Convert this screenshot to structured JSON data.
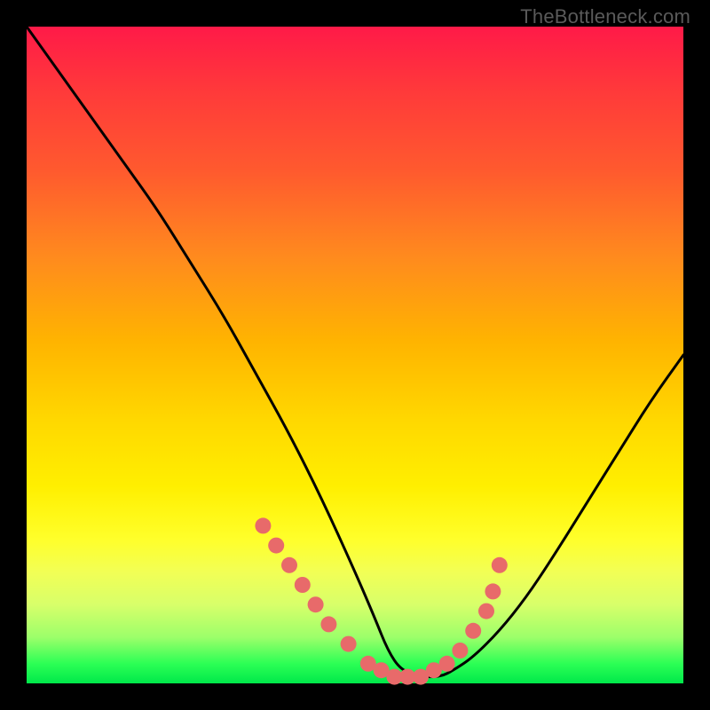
{
  "watermark": "TheBottleneck.com",
  "colors": {
    "background": "#000000",
    "gradient_top": "#ff1a48",
    "gradient_mid": "#ffd800",
    "gradient_bottom": "#00e84a",
    "curve": "#000000",
    "dots": "#e86a6a"
  },
  "chart_data": {
    "type": "line",
    "title": "",
    "xlabel": "",
    "ylabel": "",
    "x_range": [
      0,
      100
    ],
    "y_range": [
      0,
      100
    ],
    "series": [
      {
        "name": "bottleneck-curve",
        "x": [
          0,
          5,
          10,
          15,
          20,
          25,
          30,
          35,
          40,
          45,
          50,
          53,
          55,
          57,
          60,
          63,
          65,
          68,
          72,
          76,
          80,
          85,
          90,
          95,
          100
        ],
        "y": [
          100,
          93,
          86,
          79,
          72,
          64,
          56,
          47,
          38,
          28,
          17,
          10,
          5,
          2,
          1,
          1,
          2,
          4,
          8,
          13,
          19,
          27,
          35,
          43,
          50
        ]
      }
    ],
    "highlight_dots": {
      "name": "marked-points",
      "x": [
        36,
        38,
        40,
        42,
        44,
        46,
        49,
        52,
        54,
        56,
        58,
        60,
        62,
        64,
        66,
        68,
        70,
        71,
        72
      ],
      "y": [
        24,
        21,
        18,
        15,
        12,
        9,
        6,
        3,
        2,
        1,
        1,
        1,
        2,
        3,
        5,
        8,
        11,
        14,
        18
      ]
    }
  }
}
